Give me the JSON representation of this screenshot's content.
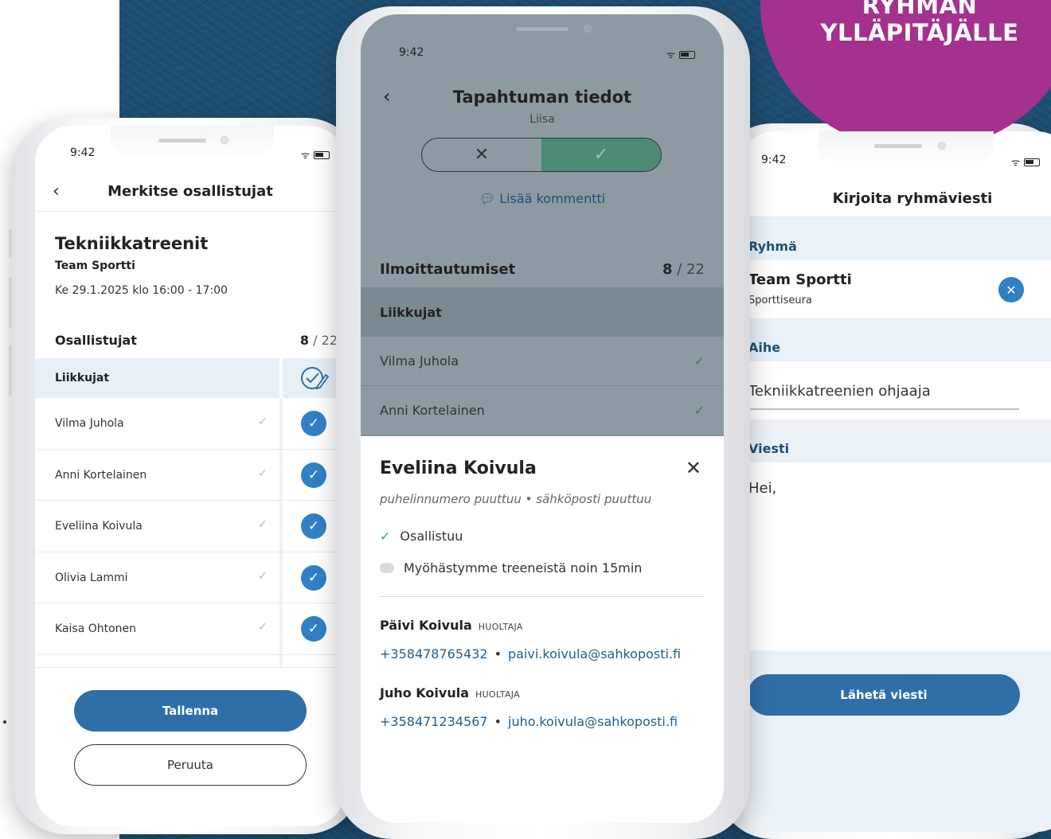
{
  "badge": {
    "line1": "RYHMÄN",
    "line2": "YLLÄPITÄJÄLLE"
  },
  "colors": {
    "background": "#1d4e72",
    "badge": "#a5318f",
    "primary": "#2f6fa8",
    "check": "#3180c4"
  },
  "phone1": {
    "status_time": "9:42",
    "title": "Merkitse osallistujat",
    "event": {
      "name": "Tekniikkatreenit",
      "team": "Team Sportti",
      "datetime": "Ke 29.1.2025 klo 16:00 - 17:00"
    },
    "participants_label": "Osallistujat",
    "count_current": "8",
    "count_total": "/ 22",
    "group": "Liikkujat",
    "members": [
      {
        "name": "Vilma Juhola",
        "attended": true
      },
      {
        "name": "Anni Kortelainen",
        "attended": true
      },
      {
        "name": "Eveliina Koivula",
        "attended": true
      },
      {
        "name": "Olivia Lammi",
        "attended": true
      },
      {
        "name": "Kaisa Ohtonen",
        "attended": true
      }
    ],
    "save_label": "Tallenna",
    "cancel_label": "Peruuta"
  },
  "phone2": {
    "status_time": "9:42",
    "title": "Tapahtuman tiedot",
    "partial_name": "Liisa",
    "comment_link": "Lisää kommentti",
    "registrations_label": "Ilmoittautumiset",
    "count_current": "8",
    "count_total": "/ 22",
    "group": "Liikkujat",
    "members": [
      {
        "name": "Vilma Juhola"
      },
      {
        "name": "Anni Kortelainen"
      }
    ],
    "sheet": {
      "name": "Eveliina Koivula",
      "missing_info": "puhelinnumero puuttuu • sähköposti puuttuu",
      "status": "Osallistuu",
      "comment": "Myöhästymme treeneistä noin 15min",
      "guardians": [
        {
          "name": "Päivi Koivula",
          "role": "HUOLTAJA",
          "phone": "+358478765432",
          "email": "paivi.koivula@sahkoposti.fi"
        },
        {
          "name": "Juho Koivula",
          "role": "HUOLTAJA",
          "phone": "+358471234567",
          "email": "juho.koivula@sahkoposti.fi"
        }
      ]
    }
  },
  "phone3": {
    "status_time": "9:42",
    "title": "Kirjoita ryhmäviesti",
    "group_label": "Ryhmä",
    "group_name": "Team Sportti",
    "group_sub": "Sporttiseura",
    "subject_label": "Aihe",
    "subject_value": "Tekniikkatreenien ohjaaja",
    "message_label": "Viesti",
    "message_value": "Hei,",
    "send_label": "Lähetä viesti"
  }
}
